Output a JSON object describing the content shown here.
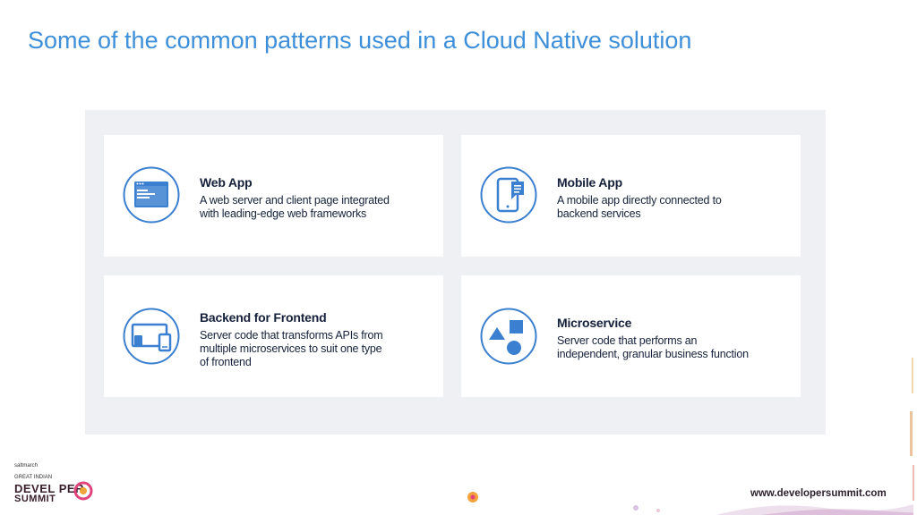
{
  "slide": {
    "title": "Some of the common patterns used in a Cloud Native solution"
  },
  "cards": [
    {
      "title": "Web App",
      "desc_lines": [
        "A web server and client page integrated",
        "with leading-edge web frameworks"
      ],
      "icon": "browser-window-icon"
    },
    {
      "title": "Mobile App",
      "desc_lines": [
        "A mobile app directly connected to",
        "backend services"
      ],
      "icon": "mobile-phone-icon"
    },
    {
      "title": "Backend for Frontend",
      "desc_lines": [
        "Server code that transforms APIs from",
        "multiple microservices to suit one type",
        "of frontend"
      ],
      "icon": "devices-icon"
    },
    {
      "title": "Microservice",
      "desc_lines": [
        "Server code that performs an",
        "independent, granular business function"
      ],
      "icon": "shapes-icon"
    }
  ],
  "footer": {
    "brand_top": "saltmarch",
    "brand_line1": "GREAT INDIAN",
    "brand_line2": "DEVEL   PER",
    "brand_line3": "SUMMIT",
    "url": "www.developersummit.com"
  },
  "colors": {
    "title": "#3d8fd9",
    "icon_blue": "#3b7fd0",
    "panel_bg": "#eef0f3",
    "text_dark": "#15213a"
  }
}
